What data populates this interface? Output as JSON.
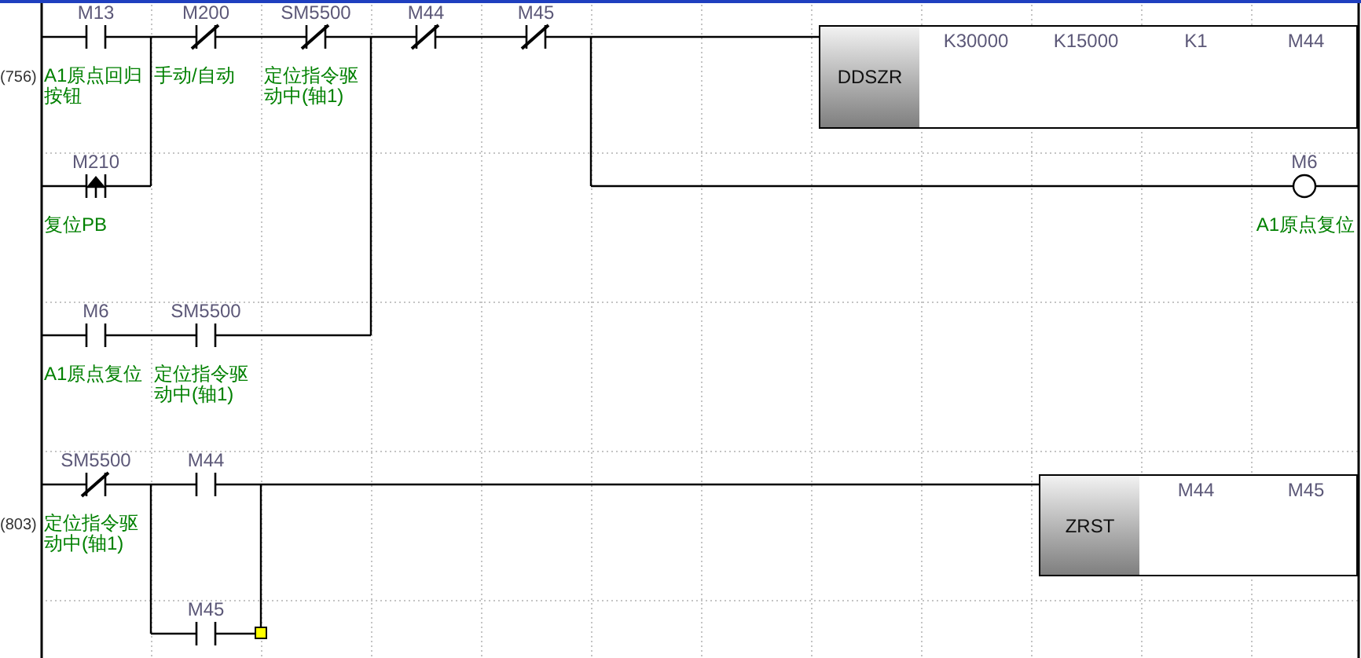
{
  "rungs": [
    {
      "step": "(756)",
      "elements": [
        {
          "kind": "contact_no",
          "device": "M13",
          "comment": "A1原点回归按钮"
        },
        {
          "kind": "contact_nc",
          "device": "M200",
          "comment": "手动/自动"
        },
        {
          "kind": "contact_nc",
          "device": "SM5500",
          "comment": "定位指令驱动中(轴1)"
        },
        {
          "kind": "contact_nc",
          "device": "M44"
        },
        {
          "kind": "contact_nc",
          "device": "M45"
        },
        {
          "kind": "contact_rising",
          "device": "M210",
          "comment": "复位PB"
        },
        {
          "kind": "contact_no",
          "device": "M6",
          "comment": "A1原点复位"
        },
        {
          "kind": "contact_no",
          "device": "SM5500",
          "comment": "定位指令驱动中(轴1)"
        },
        {
          "kind": "instruction",
          "name": "DDSZR",
          "operands": [
            "K30000",
            "K15000",
            "K1",
            "M44"
          ]
        },
        {
          "kind": "coil",
          "device": "M6",
          "comment": "A1原点复位"
        }
      ]
    },
    {
      "step": "(803)",
      "elements": [
        {
          "kind": "contact_nc",
          "device": "SM5500",
          "comment": "定位指令驱动中(轴1)"
        },
        {
          "kind": "contact_no",
          "device": "M44"
        },
        {
          "kind": "contact_no",
          "device": "M45"
        },
        {
          "kind": "instruction",
          "name": "ZRST",
          "operands": [
            "M44",
            "M45"
          ]
        }
      ]
    }
  ]
}
